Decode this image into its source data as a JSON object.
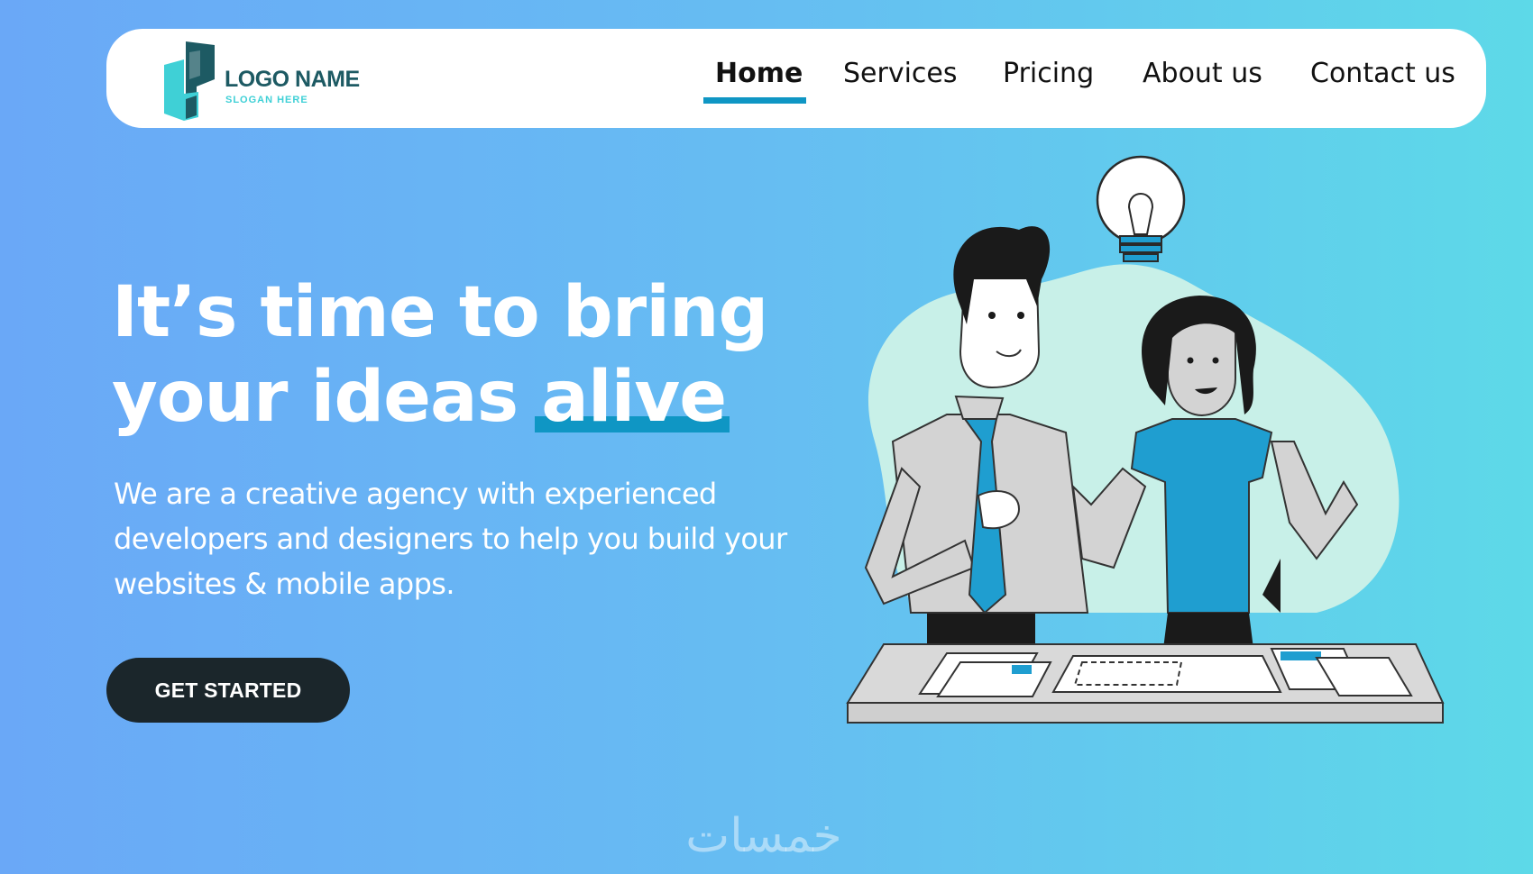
{
  "brand": {
    "name": "LOGO NAME",
    "slogan": "SLOGAN HERE"
  },
  "nav": {
    "items": [
      {
        "label": "Home",
        "active": true
      },
      {
        "label": "Services",
        "active": false
      },
      {
        "label": "Pricing",
        "active": false
      },
      {
        "label": "About us",
        "active": false
      },
      {
        "label": "Contact us",
        "active": false
      }
    ]
  },
  "hero": {
    "title_line1": "It’s time to bring",
    "title_line2_prefix": "your ideas ",
    "title_highlight": "alive",
    "subtitle": "We are a creative agency with experienced developers and designers to help you build your websites & mobile apps.",
    "cta_label": "GET STARTED"
  },
  "illustration": {
    "icon": "two-people-brainstorming-lightbulb-illustration"
  },
  "watermark": {
    "text": "خمسات"
  },
  "colors": {
    "accent": "#0f96c4",
    "cta_background": "#1b262b",
    "logo_dark": "#1d5a63",
    "logo_light": "#3fd0d6",
    "gradient_start": "#6aa8f7",
    "gradient_end": "#5dd9e8"
  }
}
